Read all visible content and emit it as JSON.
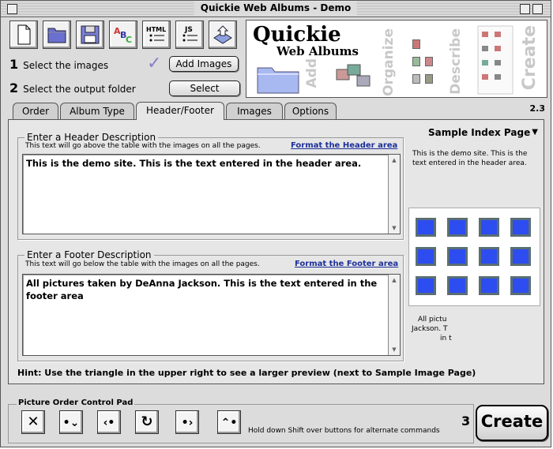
{
  "window": {
    "title": "Quickie Web Albums - Demo"
  },
  "toolbar": {
    "icons": [
      "new-document-icon",
      "open-folder-icon",
      "save-disk-icon",
      "spellcheck-icon",
      "html-icon",
      "javascript-icon",
      "upload-icon"
    ],
    "html_label": "HTML",
    "js_label": "JS",
    "abc_label": "ABC"
  },
  "steps": {
    "step1_num": "1",
    "step1_label": "Select the images",
    "add_images_button": "Add Images",
    "step2_num": "2",
    "step2_label": "Select the output folder",
    "select_button": "Select"
  },
  "banner": {
    "logo_line1": "Quickie",
    "logo_line2": "Web Albums",
    "words": [
      "Add",
      "Organize",
      "Describe",
      "Create"
    ]
  },
  "version": "2.3",
  "tabs": [
    {
      "label": "Order",
      "active": false
    },
    {
      "label": "Album Type",
      "active": false
    },
    {
      "label": "Header/Footer",
      "active": true
    },
    {
      "label": "Images",
      "active": false
    },
    {
      "label": "Options",
      "active": false
    }
  ],
  "header_section": {
    "title": "Enter a Header Description",
    "hint": "This text will go above the table with the images on all the pages.",
    "format_link": "Format the Header area",
    "value": "This is the demo site.  This is the text entered in the header area."
  },
  "footer_section": {
    "title": "Enter a Footer Description",
    "hint": "This text will go below the table with the images on all the pages.",
    "format_link": "Format the Footer area",
    "value": "All pictures taken by DeAnna Jackson.  This is the text entered in the footer area"
  },
  "preview": {
    "dropdown_label": "Sample Index Page",
    "header_text": "This is the demo site.  This is the text entered in the header area.",
    "footer_line1": "All pictu",
    "footer_line2": "Jackson. T",
    "footer_line3": "in t",
    "thumb_count": 12
  },
  "hint": "Hint: Use the triangle in the upper right to see a larger preview  (next to Sample Image Page)",
  "pad": {
    "title": "Picture Order Control Pad",
    "buttons": [
      "delete-icon",
      "move-down-icon",
      "move-left-icon",
      "rotate-icon",
      "move-right-icon",
      "move-up-icon"
    ],
    "note": "Hold down Shift over buttons for alternate commands"
  },
  "create": {
    "num": "3",
    "label": "Create"
  },
  "colors": {
    "thumb_fill": "#2d4df0",
    "thumb_border": "#5a6e74",
    "link": "#1c2f9a",
    "check": "#8a7ec9"
  }
}
